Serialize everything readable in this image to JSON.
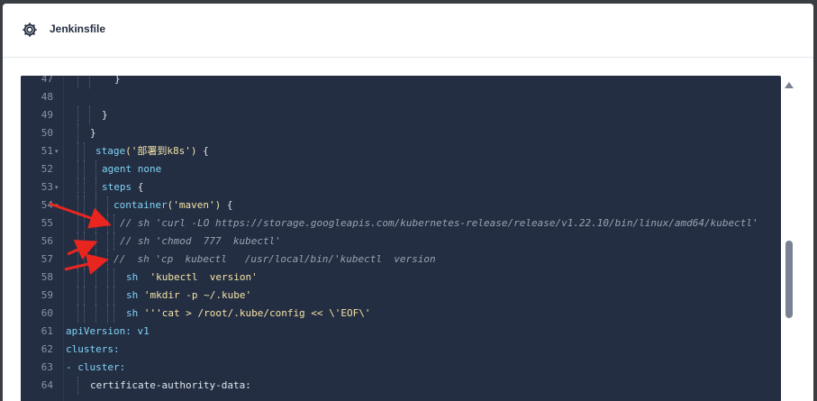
{
  "header": {
    "title": "Jenkinsfile",
    "icon": "gear-icon"
  },
  "editor": {
    "lines": [
      {
        "n": "47",
        "fold": ""
      },
      {
        "n": "48",
        "fold": ""
      },
      {
        "n": "49",
        "fold": ""
      },
      {
        "n": "50",
        "fold": ""
      },
      {
        "n": "51",
        "fold": "▾"
      },
      {
        "n": "52",
        "fold": ""
      },
      {
        "n": "53",
        "fold": "▾"
      },
      {
        "n": "54",
        "fold": "▾"
      },
      {
        "n": "55",
        "fold": ""
      },
      {
        "n": "56",
        "fold": ""
      },
      {
        "n": "57",
        "fold": ""
      },
      {
        "n": "58",
        "fold": ""
      },
      {
        "n": "59",
        "fold": ""
      },
      {
        "n": "60",
        "fold": ""
      },
      {
        "n": "61",
        "fold": ""
      },
      {
        "n": "62",
        "fold": ""
      },
      {
        "n": "63",
        "fold": ""
      },
      {
        "n": "64",
        "fold": ""
      }
    ],
    "code": {
      "l47": "}",
      "l49": "}",
      "l50": "}",
      "l51_kw": "stage",
      "l51_str": "('部署到k8s')",
      "l51_rest": " {",
      "l52": "agent none",
      "l53_kw": "steps",
      "l53_rest": " {",
      "l54_kw": "container",
      "l54_str": "('maven')",
      "l54_rest": " {",
      "l55": "// sh 'curl -LO https://storage.googleapis.com/kubernetes-release/release/v1.22.10/bin/linux/amd64/kubectl'",
      "l56": "// sh 'chmod  777  kubectl'",
      "l57": "//  sh 'cp  kubectl   /usr/local/bin/'kubectl  version",
      "l58_kw": "sh",
      "l58_str": "'kubectl  version'",
      "l59_kw": "sh",
      "l59_str": "'mkdir -p ~/.kube'",
      "l60_kw": "sh",
      "l60_str": "'''cat > /root/.kube/config << \\'EOF\\'",
      "l61": "apiVersion: v1",
      "l62": "clusters:",
      "l63": "- cluster:",
      "l64": "certificate-authority-data:"
    }
  },
  "colors": {
    "editor_bg": "#242e42",
    "keyword": "#7fd3f7",
    "string": "#f4e3a7",
    "comment": "#99a3b4",
    "arrow": "#e8261f"
  }
}
